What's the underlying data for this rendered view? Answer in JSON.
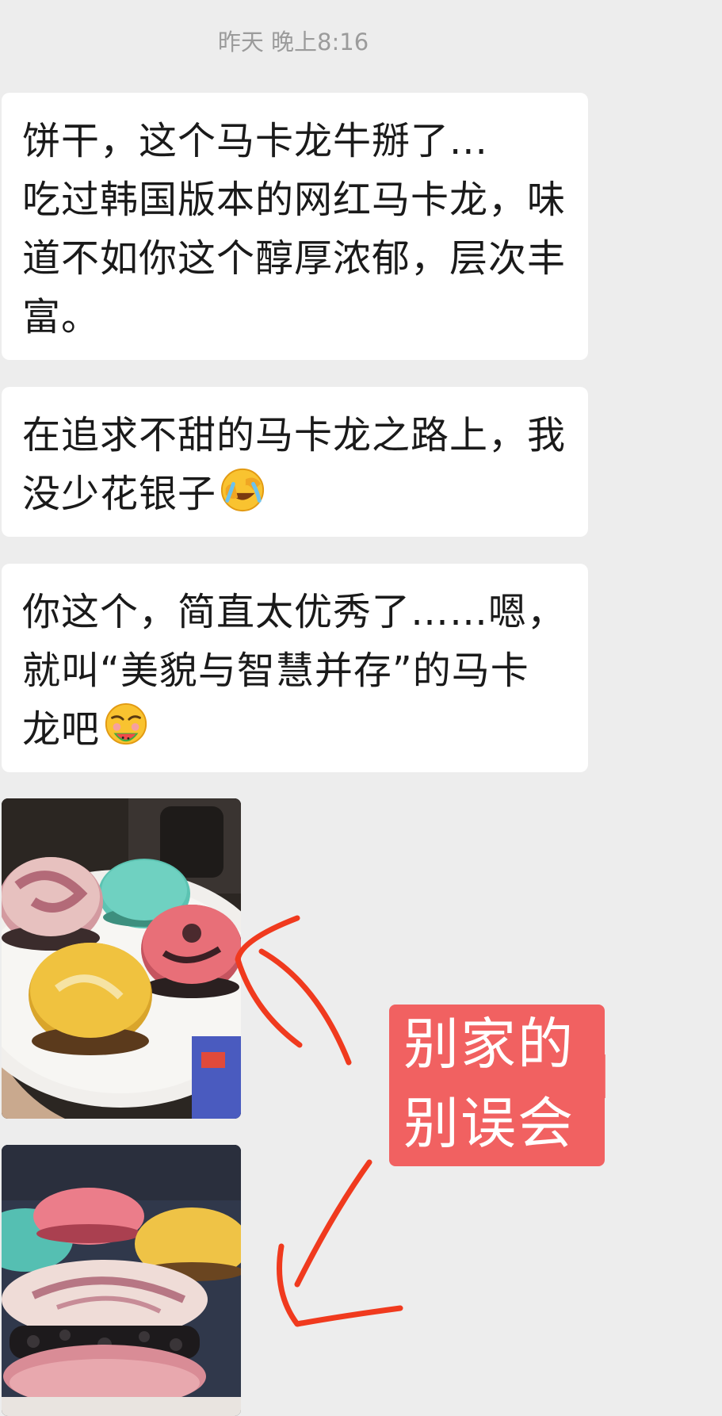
{
  "chat": {
    "timestamp": "昨天 晚上8:16",
    "messages": [
      {
        "lines": [
          "饼干，这个马卡龙牛掰了...",
          "吃过韩国版本的网红马卡龙，味",
          "道不如你这个醇厚浓郁，层次丰",
          "富。"
        ]
      },
      {
        "lines": [
          "在追求不甜的马卡龙之路上，我",
          "没少花银子"
        ],
        "emoji": "facepalm-crying-emoji"
      },
      {
        "lines": [
          "你这个，简直太优秀了……嗯，",
          "就叫“美貌与智慧并存”的马卡",
          "龙吧"
        ],
        "emoji": "eating-watermelon-emoji"
      }
    ],
    "photos": [
      {
        "name": "macarons-on-plate-photo"
      },
      {
        "name": "macaron-closeup-photo"
      }
    ]
  },
  "annotation": {
    "label_lines": [
      "别家的",
      "别误会"
    ],
    "label_color": "#f16161",
    "arrow_color": "#f03a1e"
  },
  "colors": {
    "background": "#ededed",
    "bubble": "#ffffff",
    "text": "#1a1a1a",
    "timestamp": "#9b9b9b"
  }
}
